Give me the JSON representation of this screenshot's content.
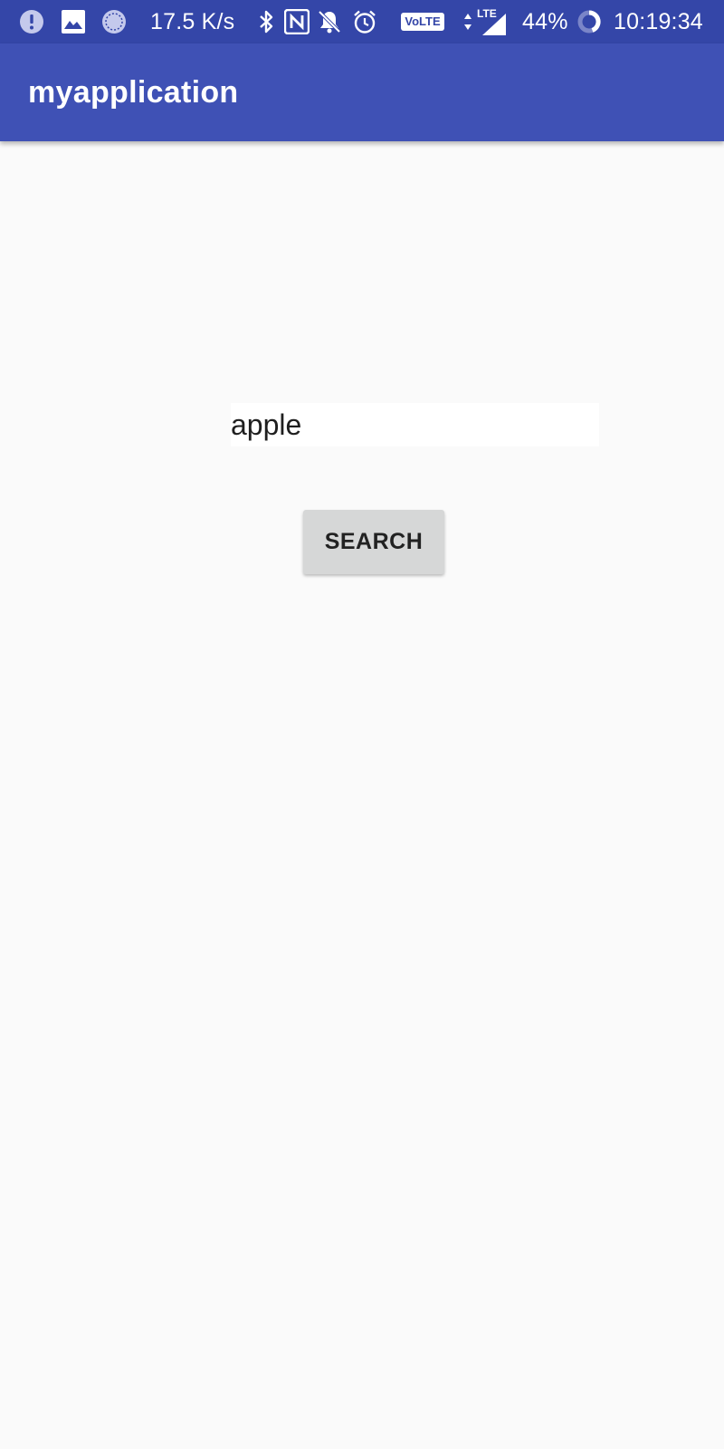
{
  "status_bar": {
    "network_speed": "17.5 K/s",
    "volte_badge": "VoLTE",
    "lte_label": "LTE",
    "battery_percent": "44%",
    "time": "10:19:34",
    "icons": [
      "alert-icon",
      "image-icon",
      "sync-icon",
      "bluetooth-icon",
      "nfc-icon",
      "notifications-off-icon",
      "alarm-icon",
      "volte-icon",
      "data-arrows-icon",
      "signal-icon",
      "battery-ring-icon"
    ],
    "background_color": "#3446a8"
  },
  "app_bar": {
    "title": "myapplication",
    "background_color": "#3f51b5"
  },
  "main": {
    "search_input": {
      "value": "apple",
      "placeholder": ""
    },
    "search_button": {
      "label": "SEARCH"
    },
    "background_color": "#fafafa"
  }
}
